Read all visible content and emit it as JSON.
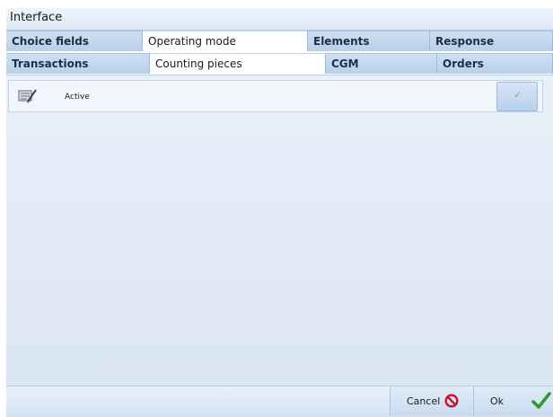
{
  "window": {
    "title": "Interface"
  },
  "tabs": {
    "row1": [
      {
        "label": "Choice fields",
        "active": false
      },
      {
        "label": "Operating mode",
        "active": true
      },
      {
        "label": "Elements",
        "active": false
      },
      {
        "label": "Response",
        "active": false
      }
    ],
    "row2": [
      {
        "label": "Transactions",
        "active": false
      },
      {
        "label": "Counting pieces",
        "active": true
      },
      {
        "label": "CGM",
        "active": false
      },
      {
        "label": "Orders",
        "active": false
      }
    ]
  },
  "options": [
    {
      "label": "Active",
      "icon": "edit-form-icon",
      "checked": false
    }
  ],
  "footer": {
    "cancel_label": "Cancel",
    "ok_label": "Ok"
  },
  "colors": {
    "accent": "#b9d0ea",
    "cancel": "#d0102a",
    "ok": "#2e9d2e"
  }
}
